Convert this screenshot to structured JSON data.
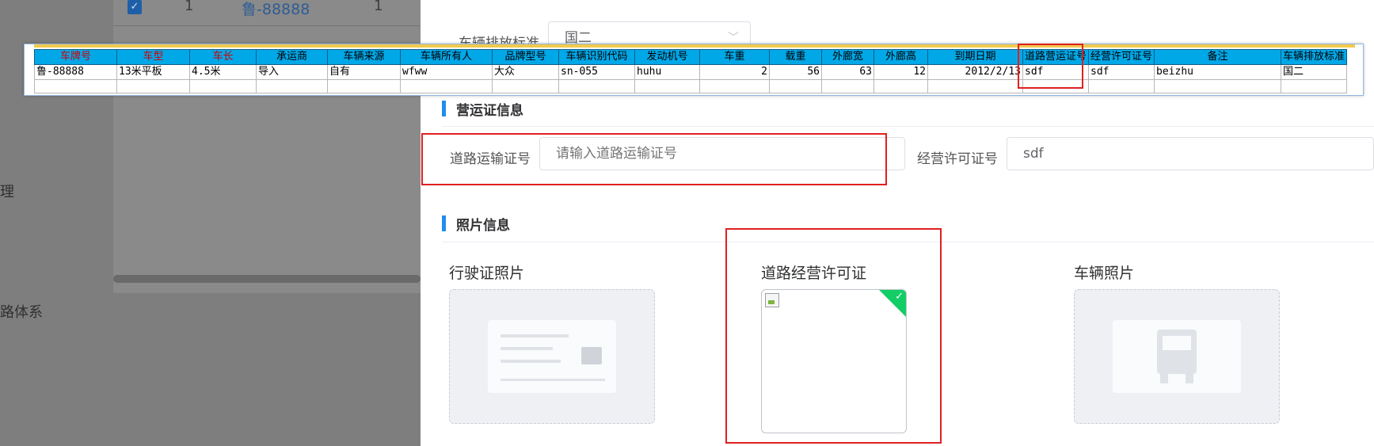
{
  "background": {
    "first_row": {
      "index": "1",
      "plate": "鲁-88888",
      "count": "1"
    },
    "menu_items": [
      "理",
      "路体系"
    ]
  },
  "drawer": {
    "emission": {
      "label": "车辆排放标准",
      "value": "国二"
    },
    "section_license": {
      "title": "营运证信息"
    },
    "road_transport": {
      "label": "道路运输证号",
      "placeholder": "请输入道路运输证号"
    },
    "business_permit": {
      "label": "经营许可证号",
      "value": "sdf"
    },
    "section_photos": {
      "title": "照片信息"
    },
    "photos": [
      {
        "label": "行驶证照片",
        "icon": "driving-license-placeholder-icon"
      },
      {
        "label": "道路经营许可证",
        "icon": "broken-image-icon"
      },
      {
        "label": "车辆照片",
        "icon": "truck-placeholder-icon"
      }
    ],
    "success_icon": "check-icon",
    "accent_color": "#1f8df0",
    "success_color": "#13ce66"
  },
  "spreadsheet": {
    "headers": [
      "车牌号",
      "车型",
      "车长",
      "承运商",
      "车辆来源",
      "车辆所有人",
      "品牌型号",
      "车辆识别代码",
      "发动机号",
      "车重",
      "载重",
      "外廊宽",
      "外廊高",
      "到期日期",
      "道路营运证号",
      "经营许可证号",
      "备注",
      "车辆排放标准"
    ],
    "required_headers": [
      "车牌号",
      "车型",
      "车长"
    ],
    "row": [
      "鲁-88888",
      "13米平板",
      "4.5米",
      "导入",
      "自有",
      "wfww",
      "大众",
      "sn-055",
      "huhu",
      "2",
      "56",
      "63",
      "12",
      "2012/2/13",
      "sdf",
      "sdf",
      "beizhu",
      "国二"
    ],
    "header_color": "#00a8e8"
  }
}
